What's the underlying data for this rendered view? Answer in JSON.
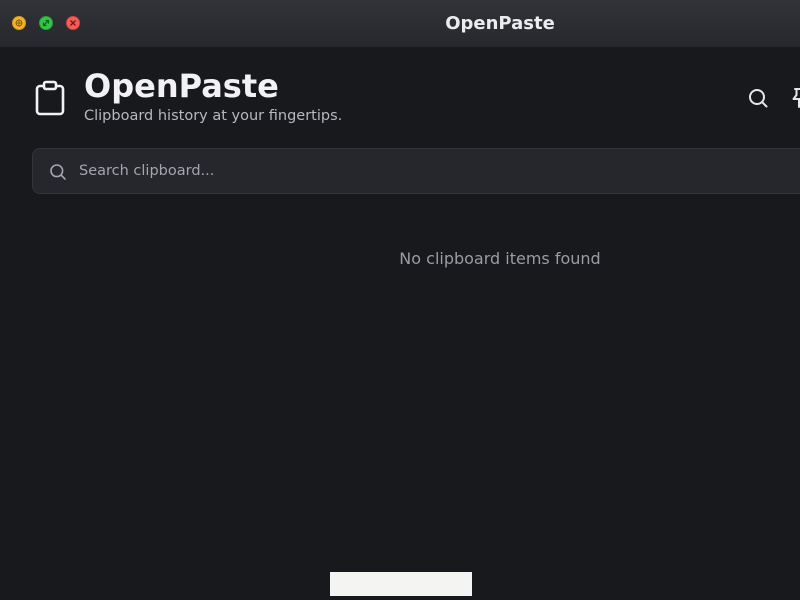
{
  "window": {
    "title": "OpenPaste",
    "controls": {
      "minimize_icon": "minimize-icon",
      "maximize_icon": "maximize-icon",
      "close_icon": "close-icon"
    }
  },
  "header": {
    "icon": "clipboard-icon",
    "app_name": "OpenPaste",
    "tagline": "Clipboard history at your fingertips.",
    "actions": {
      "search_icon": "search-icon",
      "pin_icon": "pin-icon"
    }
  },
  "search": {
    "icon": "search-icon",
    "placeholder": "Search clipboard...",
    "value": ""
  },
  "content": {
    "empty_message": "No clipboard items found"
  },
  "colors": {
    "background": "#18191d",
    "titlebar": "#2d2f34",
    "search_field": "#25272c",
    "text_primary": "#f2f2f4",
    "text_muted": "#9a9ca3"
  }
}
